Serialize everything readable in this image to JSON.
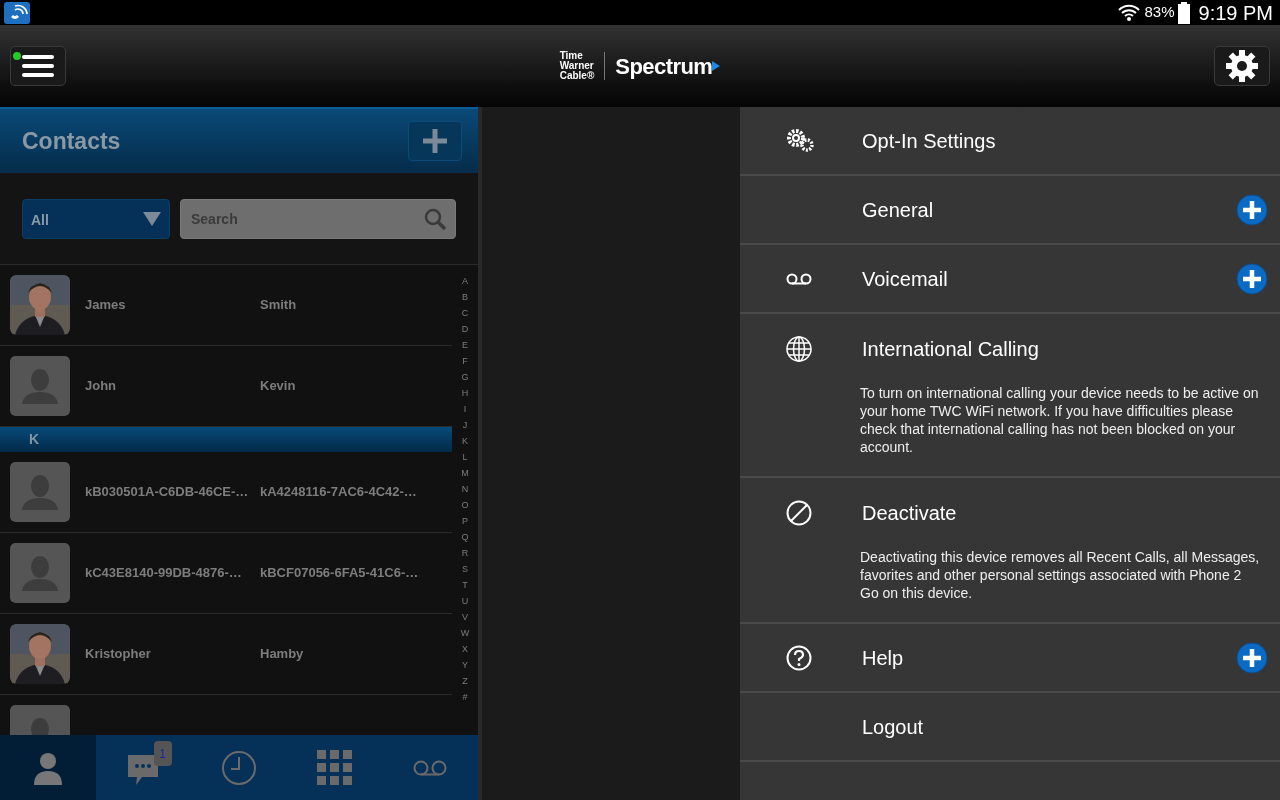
{
  "status_bar": {
    "battery_percent": "83%",
    "time": "9:19 PM"
  },
  "header": {
    "menu_online": true,
    "logo_lines": [
      "Time",
      "Warner",
      "Cable®"
    ],
    "brand": "Spectrum"
  },
  "contacts_panel": {
    "title": "Contacts",
    "filter": "All",
    "search": {
      "placeholder": "Search"
    },
    "index_letters": [
      "A",
      "B",
      "C",
      "D",
      "E",
      "F",
      "G",
      "H",
      "I",
      "J",
      "K",
      "L",
      "M",
      "N",
      "O",
      "P",
      "Q",
      "R",
      "S",
      "T",
      "U",
      "V",
      "W",
      "X",
      "Y",
      "Z",
      "#"
    ],
    "rows": [
      {
        "first_name": "James",
        "last_name": "Smith"
      },
      {
        "kind": "placeholder",
        "first_name": "John",
        "last_name": "Kevin"
      },
      {
        "kind": "section",
        "label": "K"
      },
      {
        "kind": "placeholder",
        "first_name": "kB030501A-C6DB-46CE-…",
        "last_name": "kA4248116-7AC6-4C42-…"
      },
      {
        "kind": "placeholder",
        "first_name": "kC43E8140-99DB-4876-…",
        "last_name": "kBCF07056-6FA5-41C6-…"
      },
      {
        "first_name": "Kristopher",
        "last_name": "Hamby"
      },
      {
        "kind": "partial"
      }
    ],
    "tabs": [
      {
        "kind": "person",
        "selected": true
      },
      {
        "kind": "chat",
        "selected": false,
        "badge": "1"
      },
      {
        "kind": "clock",
        "selected": false
      },
      {
        "kind": "keypad",
        "selected": false
      },
      {
        "kind": "voicemail",
        "selected": false
      }
    ]
  },
  "settings_menu": [
    {
      "kind": "gears",
      "label": "Opt-In Settings",
      "expandable": false
    },
    {
      "kind": "plain",
      "label": "General",
      "expandable": true
    },
    {
      "kind": "voicemail",
      "label": "Voicemail",
      "expandable": true
    },
    {
      "kind": "globe",
      "label": "International Calling",
      "description": "To turn on international calling your device needs to be active on your home TWC WiFi network. If you have difficulties please check that international calling has not been blocked on your account.",
      "expandable": false
    },
    {
      "kind": "block",
      "label": "Deactivate",
      "description": "Deactivating this device removes all Recent Calls, all Messages, favorites and other personal settings associated with Phone 2 Go on this device.",
      "expandable": false
    },
    {
      "kind": "help",
      "label": "Help",
      "expandable": true
    },
    {
      "kind": "plain",
      "label": "Logout",
      "expandable": false
    }
  ]
}
